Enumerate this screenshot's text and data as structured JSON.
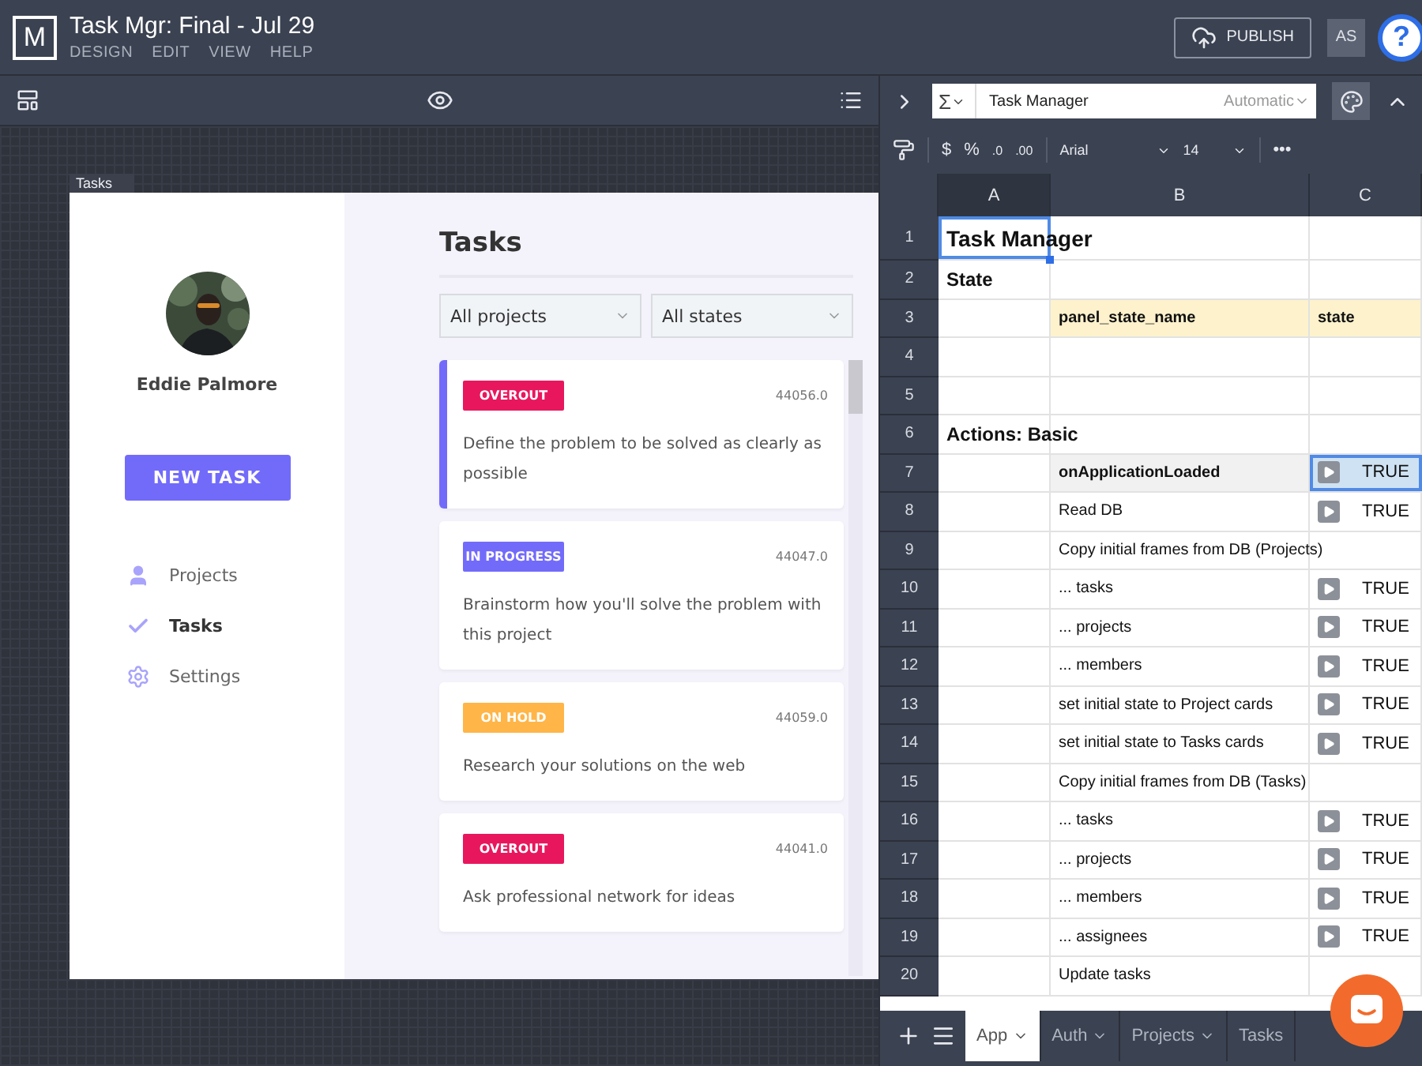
{
  "app": {
    "logo": "M",
    "title": "Task Mgr: Final - Jul 29",
    "menu": [
      "DESIGN",
      "EDIT",
      "VIEW",
      "HELP"
    ],
    "publish": "PUBLISH",
    "initials": "AS",
    "help": "?"
  },
  "canvas": {
    "frame_label": "Tasks",
    "preview": {
      "user_name": "Eddie Palmore",
      "new_task": "NEW TASK",
      "nav": [
        {
          "label": "Projects",
          "kind": "person",
          "selected": false
        },
        {
          "label": "Tasks",
          "kind": "check",
          "selected": true
        },
        {
          "label": "Settings",
          "kind": "gear",
          "selected": false
        }
      ],
      "heading": "Tasks",
      "filters": [
        {
          "value": "All projects"
        },
        {
          "value": "All states"
        }
      ],
      "tasks": [
        {
          "status": "OVEROUT",
          "kind": "overout",
          "number": "44056.0",
          "text": "Define the problem to be solved as clearly as possible",
          "selected": true
        },
        {
          "status": "IN PROGRESS",
          "kind": "progress",
          "number": "44047.0",
          "text": "Brainstorm how you'll solve the problem with this project",
          "selected": false
        },
        {
          "status": "ON HOLD",
          "kind": "hold",
          "number": "44059.0",
          "text": "Research your solutions on the web",
          "selected": false
        },
        {
          "status": "OVEROUT",
          "kind": "overout",
          "number": "44041.0",
          "text": "Ask professional network for ideas",
          "selected": false
        }
      ]
    }
  },
  "sheet": {
    "formula": {
      "function": "Σ",
      "name": "Task Manager",
      "mode": "Automatic"
    },
    "format": {
      "currency": "$",
      "percent": "%",
      "decimal_less": ".0",
      "decimal_more": ".00",
      "font": "Arial",
      "size": "14",
      "more": "•••"
    },
    "columns": [
      "A",
      "B",
      "C"
    ],
    "rows": [
      {
        "number": "1",
        "kind": "title",
        "a": "Task Manager"
      },
      {
        "number": "2",
        "kind": "section",
        "a": "State"
      },
      {
        "number": "3",
        "kind": "header",
        "b": "panel_state_name",
        "c": "state"
      },
      {
        "number": "4",
        "kind": "empty"
      },
      {
        "number": "5",
        "kind": "empty"
      },
      {
        "number": "6",
        "kind": "section",
        "a": "Actions: Basic"
      },
      {
        "number": "7",
        "kind": "action",
        "b": "onApplicationLoaded",
        "c": "TRUE",
        "selected": true
      },
      {
        "number": "8",
        "kind": "action",
        "b": "Read DB",
        "c": "TRUE",
        "selected": false
      },
      {
        "number": "9",
        "kind": "group",
        "b": "Copy initial frames from DB (Projects)"
      },
      {
        "number": "10",
        "kind": "action",
        "b": "... tasks",
        "c": "TRUE",
        "selected": false
      },
      {
        "number": "11",
        "kind": "action",
        "b": "... projects",
        "c": "TRUE",
        "selected": false
      },
      {
        "number": "12",
        "kind": "action",
        "b": "... members",
        "c": "TRUE",
        "selected": false
      },
      {
        "number": "13",
        "kind": "action",
        "b": "set initial state to Project cards",
        "c": "TRUE",
        "selected": false
      },
      {
        "number": "14",
        "kind": "action",
        "b": "set initial state to Tasks cards",
        "c": "TRUE",
        "selected": false
      },
      {
        "number": "15",
        "kind": "group",
        "b": "Copy initial frames from DB (Tasks)"
      },
      {
        "number": "16",
        "kind": "action",
        "b": "... tasks",
        "c": "TRUE",
        "selected": false
      },
      {
        "number": "17",
        "kind": "action",
        "b": "... projects",
        "c": "TRUE",
        "selected": false
      },
      {
        "number": "18",
        "kind": "action",
        "b": "... members",
        "c": "TRUE",
        "selected": false
      },
      {
        "number": "19",
        "kind": "action",
        "b": "... assignees",
        "c": "TRUE",
        "selected": false
      },
      {
        "number": "20",
        "kind": "group",
        "b": "Update tasks"
      }
    ],
    "tabs": [
      {
        "label": "App",
        "selected": true,
        "caret": true
      },
      {
        "label": "Auth",
        "selected": false,
        "caret": true
      },
      {
        "label": "Projects",
        "selected": false,
        "caret": true
      },
      {
        "label": "Tasks",
        "selected": false,
        "caret": false
      }
    ]
  }
}
